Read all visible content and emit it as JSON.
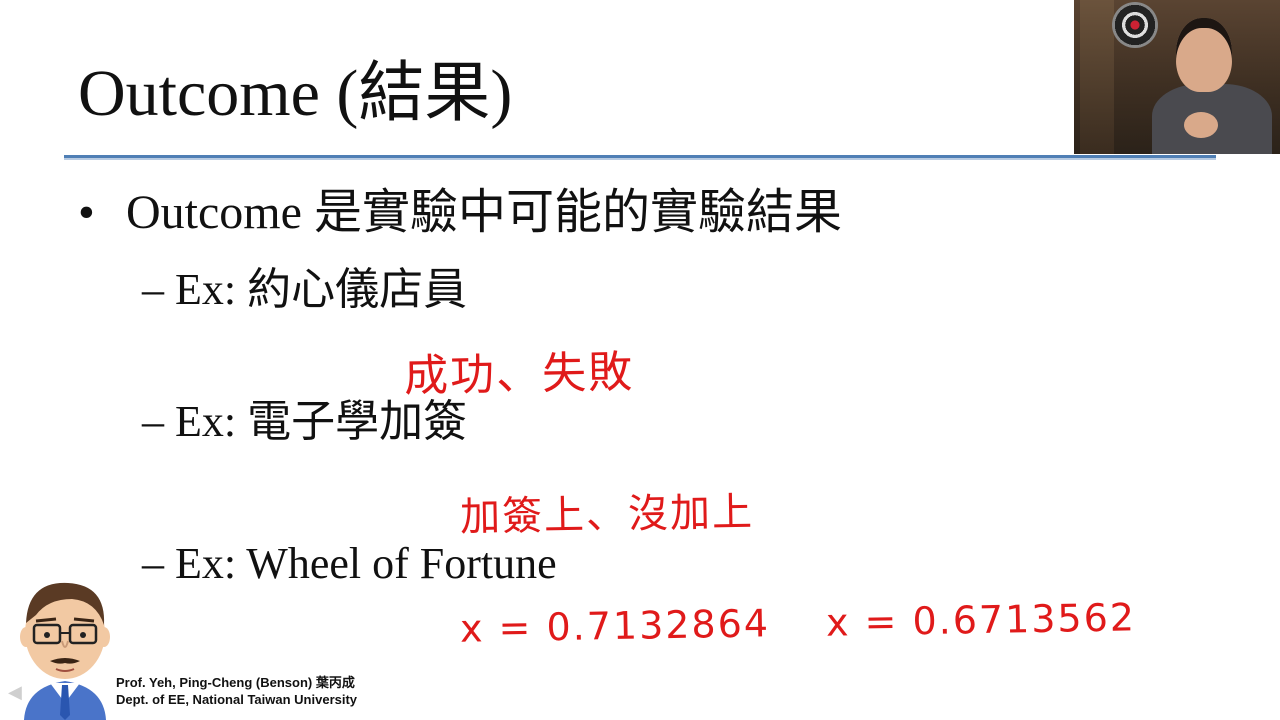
{
  "slide": {
    "title": "Outcome (結果)",
    "bullet": {
      "marker": "•",
      "text": "Outcome 是實驗中可能的實驗結果"
    },
    "sub_items": [
      {
        "dash": "–",
        "text": "Ex: 約心儀店員",
        "annotation": "成功、失敗"
      },
      {
        "dash": "–",
        "text": "Ex: 電子學加簽",
        "annotation": "加簽上、沒加上"
      },
      {
        "dash": "–",
        "text": "Ex: Wheel of Fortune",
        "annotation_left": "x = 0.7132864",
        "annotation_right": "x = 0.6713562"
      }
    ],
    "footer": {
      "line1": "Prof. Yeh, Ping-Cheng (Benson) 葉丙成",
      "line2": "Dept. of EE,  National Taiwan University"
    }
  },
  "colors": {
    "title_rule": "#4f7fb5",
    "handwriting": "#e01a1a",
    "text": "#111111"
  },
  "icons": {
    "webcam": "lecturer-webcam-video",
    "avatar": "professor-cartoon-avatar",
    "nav": "previous-slide-arrow-icon"
  }
}
